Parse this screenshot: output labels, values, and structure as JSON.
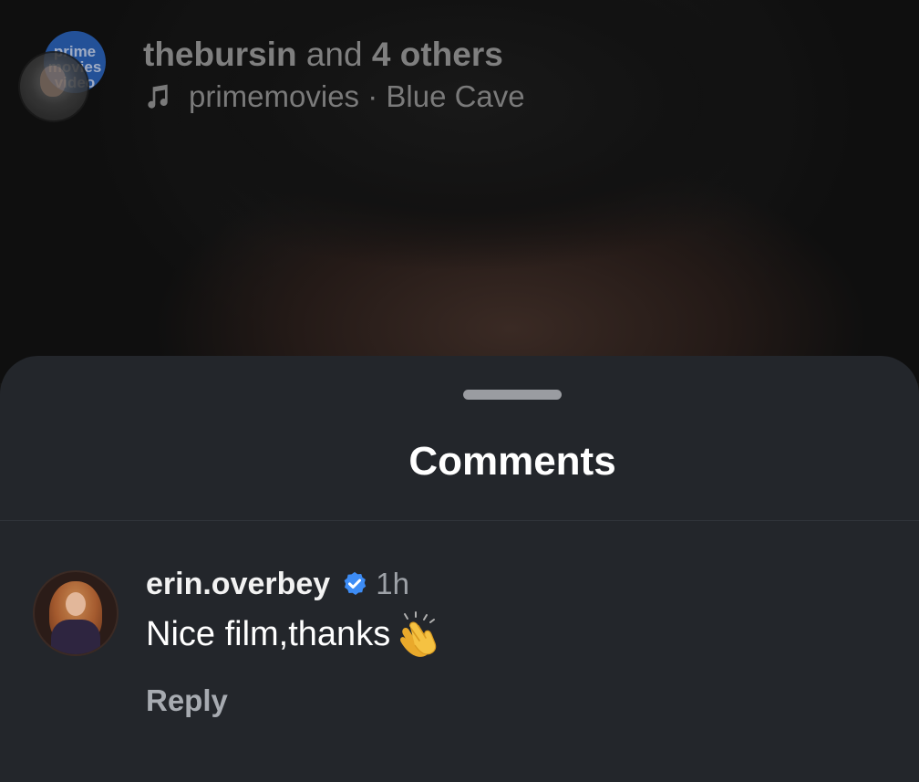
{
  "post_header": {
    "brand_avatar_lines": [
      "prime",
      "movies",
      "video"
    ],
    "user": "thebursin",
    "joiner": "and",
    "others": "4 others",
    "audio": {
      "icon": "music-note-icon",
      "text": "primemovies · Blue Cave"
    }
  },
  "sheet": {
    "title": "Comments"
  },
  "comments": [
    {
      "username": "erin.overbey",
      "verified_icon": "verified-badge-icon",
      "time": "1h",
      "text": "Nice film,thanks",
      "emoji_icon": "clapping-hands-icon",
      "reply_label": "Reply"
    }
  ],
  "colors": {
    "sheet_bg": "#23262b",
    "verified": "#3d8cf5",
    "secondary_text": "#9ea2a8"
  }
}
